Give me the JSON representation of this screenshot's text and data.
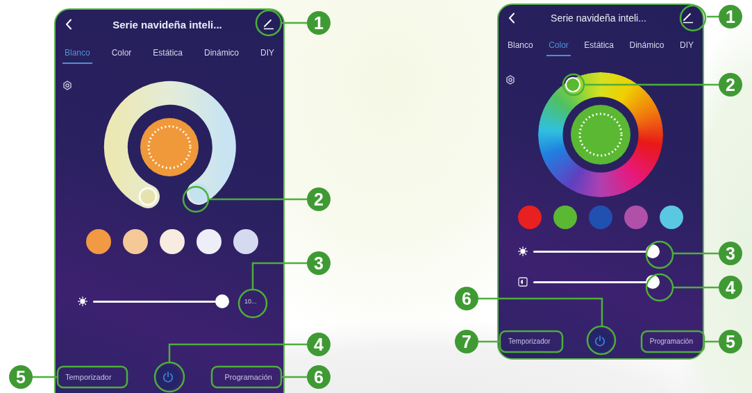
{
  "phones": [
    {
      "title": "Serie navideña inteli...",
      "tabs": [
        {
          "label": "Blanco",
          "selected": true
        },
        {
          "label": "Color",
          "selected": false
        },
        {
          "label": "Estática",
          "selected": false
        },
        {
          "label": "Dinámico",
          "selected": false
        },
        {
          "label": "DIY",
          "selected": false
        }
      ],
      "wheel": {
        "kind": "white"
      },
      "swatches": [
        {
          "color": "#f29a43"
        },
        {
          "color": "#f5c898"
        },
        {
          "color": "#f8ebe0"
        },
        {
          "color": "#eeeef8"
        },
        {
          "color": "#d6daf0"
        }
      ],
      "sliders": [
        {
          "kind": "brightness",
          "level": 1,
          "value": "10..."
        }
      ],
      "bottom_bar": {
        "left": "Temporizador",
        "right": "Programación"
      },
      "callouts": [
        {
          "number": "1"
        },
        {
          "number": "2"
        },
        {
          "number": "3"
        },
        {
          "number": "4"
        },
        {
          "number": "5"
        },
        {
          "number": "6"
        }
      ]
    },
    {
      "title": "Serie navideña inteli...",
      "tabs": [
        {
          "label": "Blanco",
          "selected": false
        },
        {
          "label": "Color",
          "selected": true
        },
        {
          "label": "Estática",
          "selected": false
        },
        {
          "label": "Dinámico",
          "selected": false
        },
        {
          "label": "DIY",
          "selected": false
        }
      ],
      "wheel": {
        "kind": "color"
      },
      "swatches": [
        {
          "color": "#e82020"
        },
        {
          "color": "#5ab832"
        },
        {
          "color": "#2050b0"
        },
        {
          "color": "#b050a8"
        },
        {
          "color": "#5ac8e0"
        }
      ],
      "sliders": [
        {
          "kind": "brightness",
          "level": 1
        },
        {
          "kind": "saturation",
          "level": 1
        }
      ],
      "bottom_bar": {
        "left": "Temporizador",
        "right": "Programación"
      },
      "callouts": [
        {
          "number": "1"
        },
        {
          "number": "2"
        },
        {
          "number": "3"
        },
        {
          "number": "4"
        },
        {
          "number": "6"
        },
        {
          "number": "7"
        },
        {
          "number": "5"
        }
      ]
    }
  ]
}
